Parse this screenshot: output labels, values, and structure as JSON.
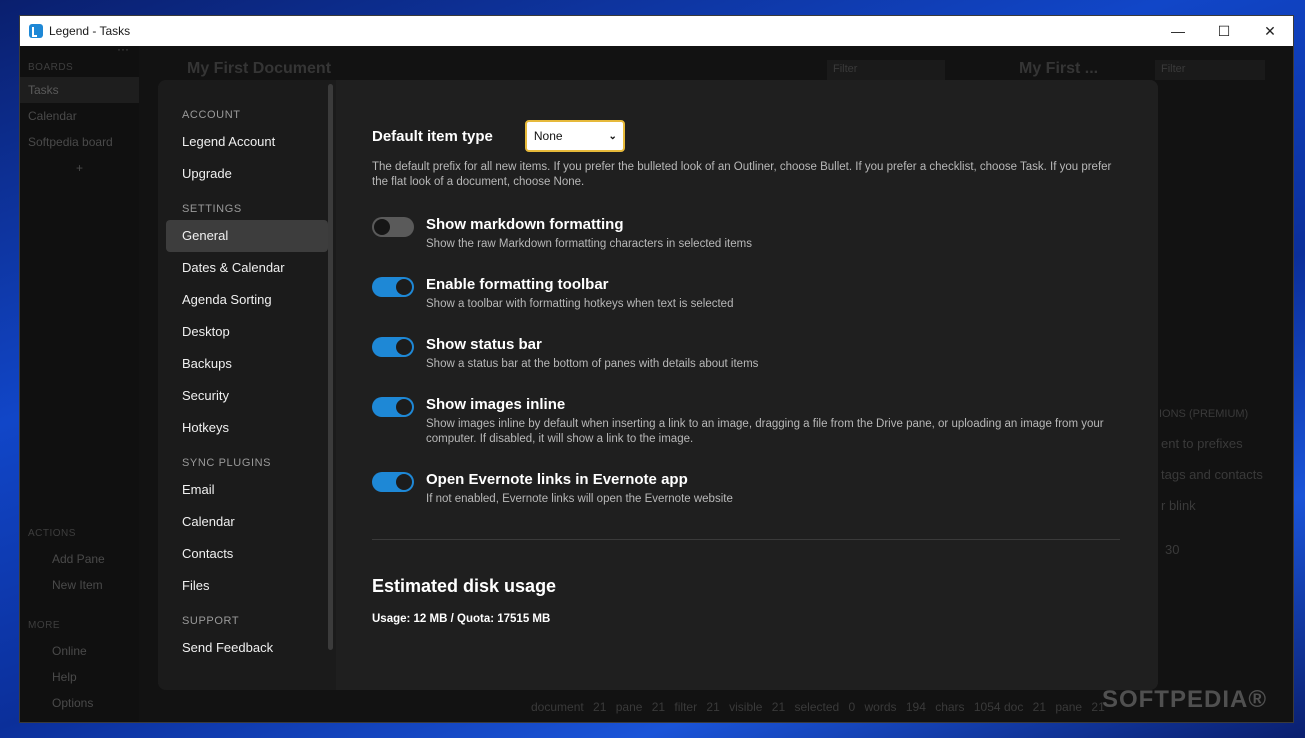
{
  "window": {
    "title": "Legend - Tasks"
  },
  "background": {
    "sidebar": {
      "boards_label": "BOARDS",
      "boards": [
        "Tasks",
        "Calendar",
        "Softpedia board"
      ],
      "add": "+",
      "actions_label": "ACTIONS",
      "actions": [
        "Add Pane",
        "New Item"
      ],
      "more_label": "MORE",
      "more": [
        "Online",
        "Help",
        "Options"
      ]
    },
    "pane1_title": "My First Document",
    "pane2_title": "My First ...",
    "filter_placeholder": "Filter",
    "status_left": "document 21  pane 21  filter 21  visible 21  selected 0  words 194  chars 1054",
    "status_right": "doc 21  pane 21",
    "right_texts": [
      "IONS (PREMIUM)",
      "ent to prefixes",
      "tags and contacts",
      "r blink",
      "30"
    ]
  },
  "watermark": "SOFTPEDIA®",
  "settings": {
    "nav": [
      {
        "section": "ACCOUNT",
        "items": [
          "Legend Account",
          "Upgrade"
        ]
      },
      {
        "section": "SETTINGS",
        "items": [
          "General",
          "Dates & Calendar",
          "Agenda Sorting",
          "Desktop",
          "Backups",
          "Security",
          "Hotkeys"
        ]
      },
      {
        "section": "SYNC PLUGINS",
        "items": [
          "Email",
          "Calendar",
          "Contacts",
          "Files"
        ]
      },
      {
        "section": "SUPPORT",
        "items": [
          "Send Feedback"
        ]
      }
    ],
    "active_item": "General",
    "default_item_type": {
      "label": "Default item type",
      "value": "None",
      "description": "The default prefix for all new items. If you prefer the bulleted look of an Outliner, choose Bullet. If you prefer a checklist, choose Task. If you prefer the flat look of a document, choose None."
    },
    "toggles": [
      {
        "title": "Show markdown formatting",
        "sub": "Show the raw Markdown formatting characters in selected items",
        "on": false
      },
      {
        "title": "Enable formatting toolbar",
        "sub": "Show a toolbar with formatting hotkeys when text is selected",
        "on": true
      },
      {
        "title": "Show status bar",
        "sub": "Show a status bar at the bottom of panes with details about items",
        "on": true
      },
      {
        "title": "Show images inline",
        "sub": "Show images inline by default when inserting a link to an image, dragging a file from the Drive pane, or uploading an image from your computer. If disabled, it will show a link to the image.",
        "on": true
      },
      {
        "title": "Open Evernote links in Evernote app",
        "sub": "If not enabled, Evernote links will open the Evernote website",
        "on": true
      }
    ],
    "disk": {
      "title": "Estimated disk usage",
      "usage": "Usage: 12 MB / Quota: 17515 MB"
    },
    "colors": {
      "accent": "#1e88d6",
      "focus": "#e6b93a"
    }
  }
}
